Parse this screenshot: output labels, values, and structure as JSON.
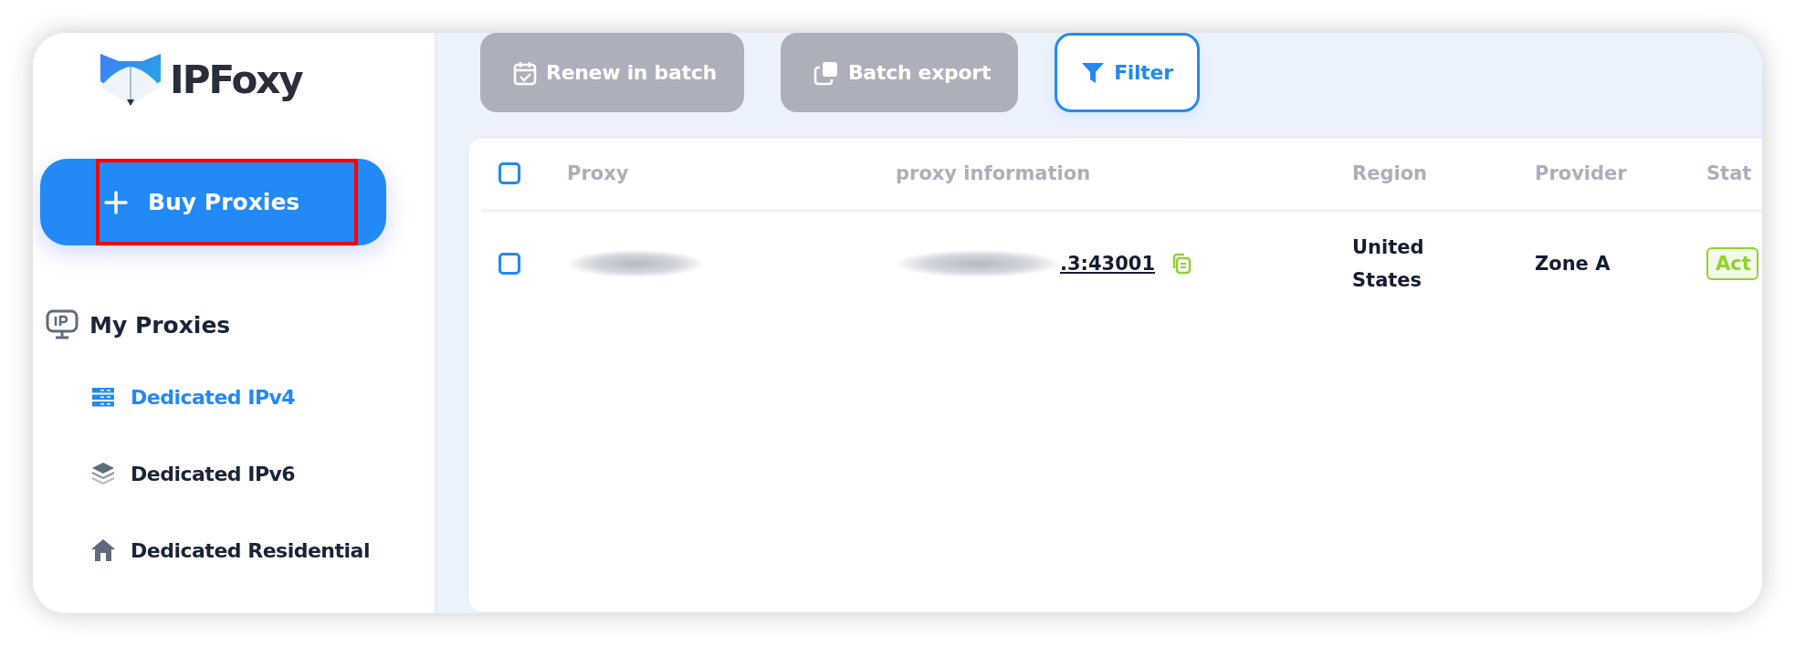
{
  "logo": {
    "name": "IPFoxy"
  },
  "sidebar": {
    "primary_button": {
      "label": "Buy Proxies",
      "highlighted": true
    },
    "section": {
      "label": "My Proxies"
    },
    "items": [
      {
        "label": "Dedicated IPv4",
        "kind": "server",
        "selected": true
      },
      {
        "label": "Dedicated IPv6",
        "kind": "layers",
        "selected": false
      },
      {
        "label": "Dedicated Residential",
        "kind": "house",
        "selected": false
      }
    ]
  },
  "toolbar": {
    "buttons": [
      {
        "label": "Renew in batch",
        "kind": "calendar",
        "disabled": true
      },
      {
        "label": "Batch export",
        "kind": "copy",
        "disabled": true
      },
      {
        "label": "Filter",
        "kind": "filter",
        "disabled": false
      }
    ]
  },
  "table": {
    "select_all": {
      "checked": false
    },
    "columns": [
      "Proxy",
      "proxy information",
      "Region",
      "Provider",
      "Stat"
    ],
    "rows": [
      {
        "checked": false,
        "proxy": {
          "blurred": true
        },
        "proxy_information": {
          "blurred": true,
          "visible_text": ".3:43001"
        },
        "region": "United States",
        "provider": "Zone A",
        "status": "Act"
      }
    ]
  }
}
